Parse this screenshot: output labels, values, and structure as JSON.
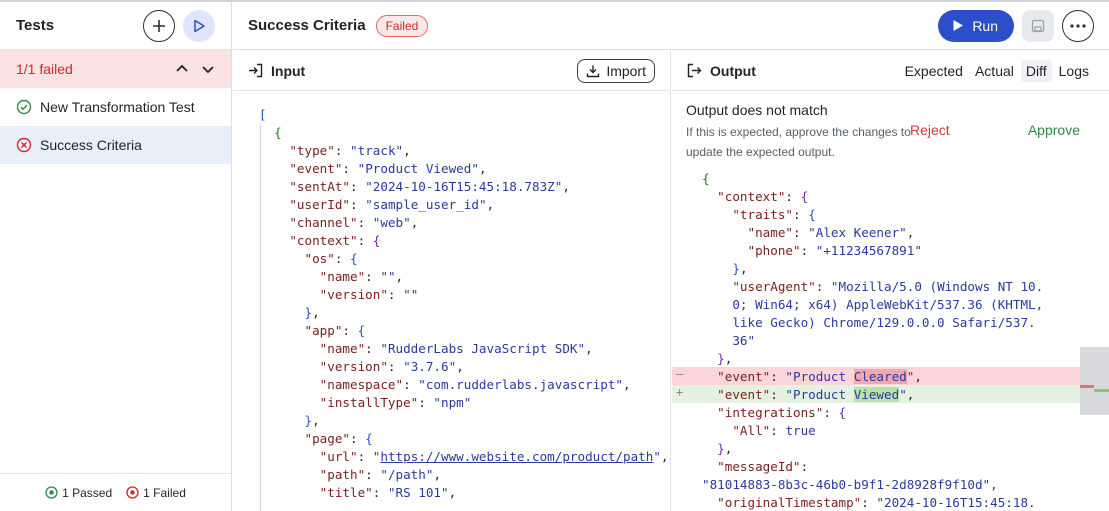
{
  "sidebar": {
    "title": "Tests",
    "failed_summary": "1/1 failed",
    "tests": [
      {
        "name": "New Transformation Test",
        "status": "passed"
      },
      {
        "name": "Success Criteria",
        "status": "failed"
      }
    ],
    "footer": {
      "passed": "1 Passed",
      "failed": "1 Failed"
    }
  },
  "header": {
    "title": "Success Criteria",
    "badge": "Failed",
    "run_label": "Run"
  },
  "input_panel": {
    "title": "Input",
    "import_label": "Import"
  },
  "output_panel": {
    "title": "Output",
    "tabs": [
      "Expected",
      "Actual",
      "Diff",
      "Logs"
    ],
    "active_tab": "Diff",
    "notice": {
      "title": "Output does not match",
      "description": "If this is expected, approve the changes to update the expected output.",
      "reject_label": "Reject",
      "approve_label": "Approve"
    }
  },
  "input_json": {
    "type": "track",
    "event": "Product Viewed",
    "sentAt": "2024-10-16T15:45:18.783Z",
    "userId": "sample_user_id",
    "channel": "web",
    "os_name": "",
    "os_version": "",
    "app_name": "RudderLabs JavaScript SDK",
    "app_version": "3.7.6",
    "app_namespace": "com.rudderlabs.javascript",
    "app_installType": "npm",
    "page_url": "https://www.website.com/product/path",
    "page_path": "/path",
    "page_title": "RS 101"
  },
  "output_json": {
    "traits_name": "Alex Keener",
    "traits_phone": "+11234567891",
    "userAgent_1": "\"Mozilla/5.0 (Windows NT 10.",
    "userAgent_2": "0; Win64; x64) AppleWebKit/537.36 (KHTML,",
    "userAgent_3": "like Gecko) Chrome/129.0.0.0 Safari/537.",
    "userAgent_4": "36\"",
    "event_expected_prefix": "Product ",
    "event_expected_word": "Cleared",
    "event_actual_prefix": "Product ",
    "event_actual_word": "Viewed",
    "integrations_all": "true",
    "messageId": "\"81014883-8b3c-46b0-b9f1-2d8928f9f10d\",",
    "originalTimestamp": "\"2024-10-16T15:45:18."
  },
  "colors": {
    "accent": "#2b4fc8",
    "failed": "#c92a2a",
    "approve": "#2f8a4c",
    "diff_removed": "#fbd5d8",
    "diff_added": "#e4f2df"
  }
}
